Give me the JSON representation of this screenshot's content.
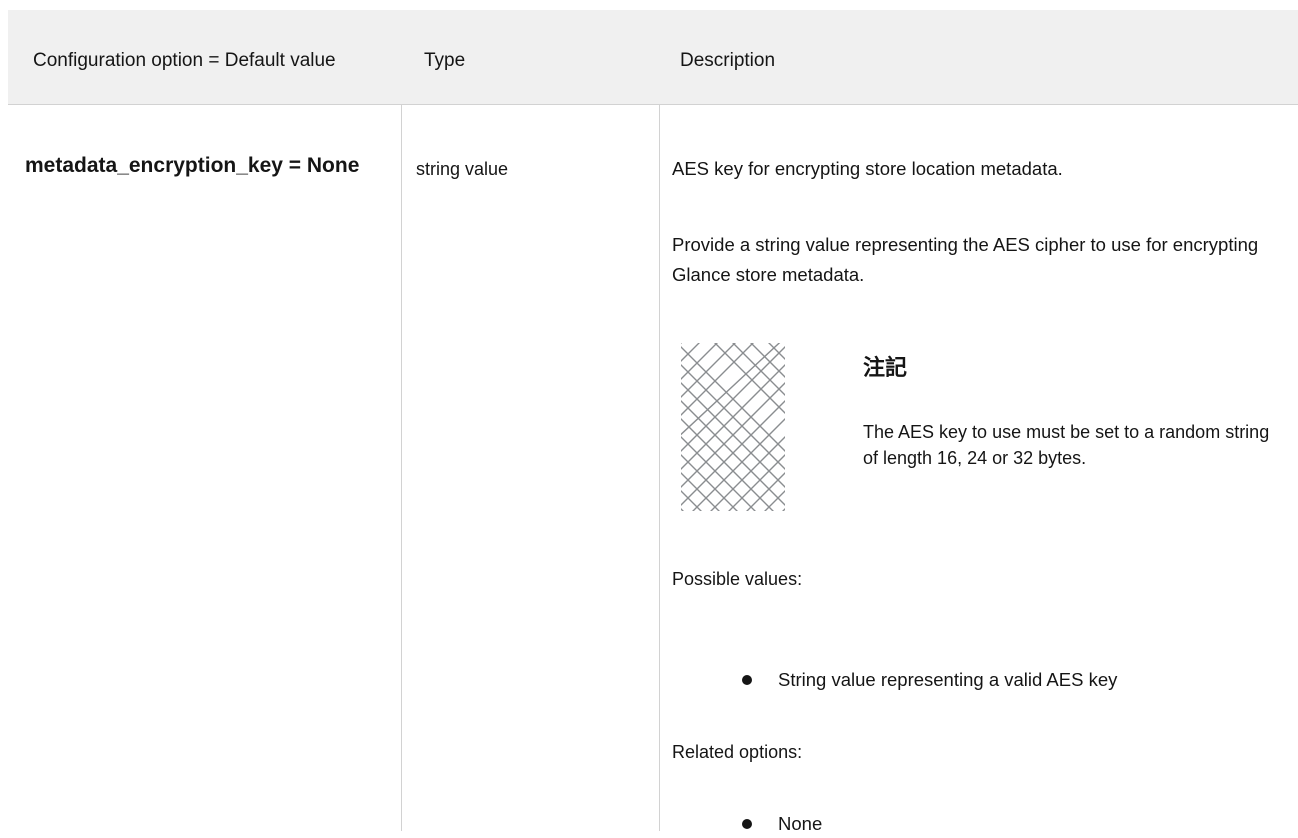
{
  "table": {
    "headers": {
      "option": "Configuration option = Default value",
      "type": "Type",
      "description": "Description"
    },
    "row": {
      "option": "metadata_encryption_key = None",
      "type": "string value",
      "description": {
        "p1": "AES key for encrypting store location metadata.",
        "p2": "Provide a string value representing the AES cipher to use for encrypting Glance store metadata.",
        "note": {
          "icon": "note-pattern-icon",
          "title": "注記",
          "body": "The AES key to use must be set to a random string of length 16, 24 or 32 bytes."
        },
        "possible_values_label": "Possible values:",
        "possible_values": [
          "String value representing a valid AES key"
        ],
        "related_options_label": "Related options:",
        "related_options": [
          "None"
        ]
      }
    }
  }
}
